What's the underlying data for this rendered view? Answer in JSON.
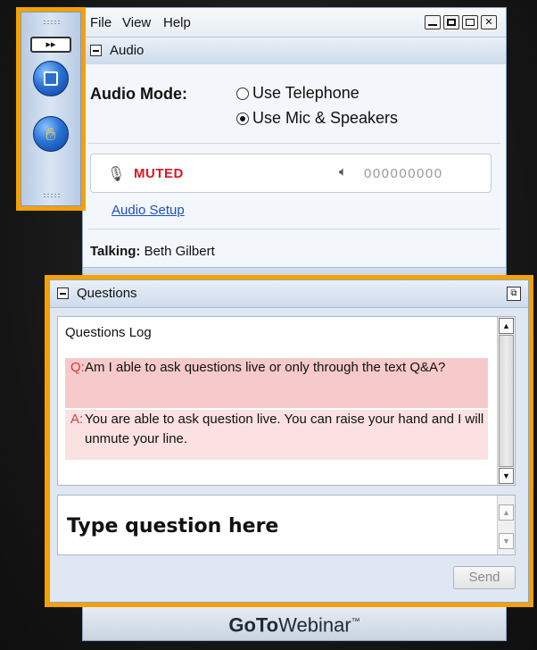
{
  "menubar": {
    "items": [
      "File",
      "View",
      "Help"
    ],
    "window_buttons": [
      "minimize",
      "restore",
      "popout",
      "close"
    ]
  },
  "audio": {
    "section_title": "Audio",
    "mode_label": "Audio Mode:",
    "options": [
      {
        "label": "Use Telephone",
        "selected": false
      },
      {
        "label": "Use Mic & Speakers",
        "selected": true
      }
    ],
    "mic_status": "MUTED",
    "speaker_level": "000000000",
    "setup_link": "Audio Setup",
    "talking_label": "Talking:",
    "talking_name": "Beth Gilbert"
  },
  "questions": {
    "section_title": "Questions",
    "log_title": "Questions Log",
    "entries": [
      {
        "prefix": "Q:",
        "text": "Am I able to ask questions live or only through the text Q&A?"
      },
      {
        "prefix": "A:",
        "text": "You are able to ask question live. You can raise your hand and I will unmute your line."
      }
    ],
    "input_placeholder": "Type question here",
    "send_label": "Send"
  },
  "grabtab": {
    "expand_symbol": "▸▸"
  },
  "brand": {
    "goto": "GoTo",
    "webinar": "Webinar",
    "tm": "™"
  },
  "colors": {
    "highlight": "#f5a100",
    "muted": "#e0141e",
    "link": "#1b4fc2",
    "question_bg": "#f6caca",
    "answer_bg": "#fbe1e1"
  },
  "icons": {
    "mic": "microphone-icon",
    "speaker": "speaker-icon",
    "screen": "screen-icon",
    "hand": "raise-hand-icon"
  }
}
